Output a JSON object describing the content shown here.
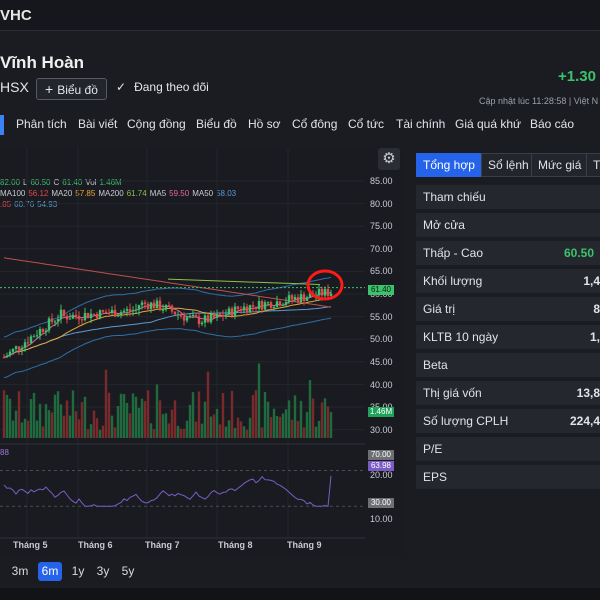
{
  "header": {
    "ticker": "VHC",
    "company": "Vĩnh Hoàn",
    "exchange": "HSX",
    "chart_button": "Biểu đồ",
    "follow_label": "Đang theo dõi",
    "change": "+1.30",
    "updated": "Cập nhật lúc  11:28:58 | Việt N"
  },
  "tabs": [
    "Phân tích",
    "Bài viết",
    "Cộng đồng",
    "Biểu đồ",
    "Hồ sơ",
    "Cổ đông",
    "Cổ tức",
    "Tài chính",
    "Giá quá khứ",
    "Báo cáo"
  ],
  "chart": {
    "legend1": [
      {
        "text": "82.00",
        "color": "#3cc26b"
      },
      {
        "text": "L",
        "color": "#c8ccd2"
      },
      {
        "text": "60.50",
        "color": "#3cc26b"
      },
      {
        "text": "C",
        "color": "#c8ccd2"
      },
      {
        "text": "61.40",
        "color": "#3cc26b"
      },
      {
        "text": "Vol",
        "color": "#c8ccd2"
      },
      {
        "text": "1.46M",
        "color": "#3cc26b"
      }
    ],
    "legend2": [
      {
        "text": "MA100",
        "color": "#c8ccd2"
      },
      {
        "text": "56.12",
        "color": "#e24a4a"
      },
      {
        "text": "MA20",
        "color": "#c8ccd2"
      },
      {
        "text": "57.85",
        "color": "#e8a838"
      },
      {
        "text": "MA200",
        "color": "#c8ccd2"
      },
      {
        "text": "61.74",
        "color": "#8bc34a"
      },
      {
        "text": "MA5",
        "color": "#c8ccd2"
      },
      {
        "text": "59.50",
        "color": "#e06aa0"
      },
      {
        "text": "MA50",
        "color": "#c8ccd2"
      },
      {
        "text": "58.03",
        "color": "#5b9bd5"
      }
    ],
    "legend3": [
      {
        "text": ".85",
        "color": "#e24a4a"
      },
      {
        "text": "60.76",
        "color": "#5b9bd5"
      },
      {
        "text": "54.93",
        "color": "#5b9bd5"
      }
    ],
    "rsi_label": "88",
    "y_ticks": [
      "85.00",
      "80.00",
      "75.00",
      "70.00",
      "65.00",
      "60.00",
      "55.00",
      "50.00",
      "45.00",
      "40.00",
      "35.00",
      "30.00"
    ],
    "rsi_ticks": [
      "20.00",
      "10.00"
    ],
    "price_badge": "61.40",
    "vol_badge": "1.46M",
    "rsi_badge_top": "70.00",
    "rsi_badge_val": "63.98",
    "rsi_badge_bottom": "30.00",
    "x_ticks": [
      "Tháng 5",
      "Tháng 6",
      "Tháng 7",
      "Tháng 8",
      "Tháng 9"
    ]
  },
  "ranges": [
    {
      "label": "3m",
      "active": false
    },
    {
      "label": "6m",
      "active": true
    },
    {
      "label": "1y",
      "active": false
    },
    {
      "label": "3y",
      "active": false
    },
    {
      "label": "5y",
      "active": false
    }
  ],
  "right_tabs": [
    "Tổng hợp",
    "Sổ lệnh",
    "Mức giá",
    "T"
  ],
  "stats": [
    {
      "label": "Tham chiếu",
      "value": ""
    },
    {
      "label": "Mở cửa",
      "value": ""
    },
    {
      "label": "Thấp - Cao",
      "value": "60.50",
      "green": true
    },
    {
      "label": "Khối lượng",
      "value": "1,4"
    },
    {
      "label": "Giá trị",
      "value": "8"
    },
    {
      "label": "KLTB 10 ngày",
      "value": "1,"
    },
    {
      "label": "Beta",
      "value": ""
    },
    {
      "label": "Thị giá vốn",
      "value": "13,8"
    },
    {
      "label": "Số lượng CPLH",
      "value": "224,4"
    },
    {
      "label": "P/E",
      "value": ""
    },
    {
      "label": "EPS",
      "value": ""
    }
  ],
  "colors": {
    "up": "#3cc26b",
    "down": "#e24a4a",
    "accent": "#2563eb",
    "annotation": "#ff1a1a"
  }
}
